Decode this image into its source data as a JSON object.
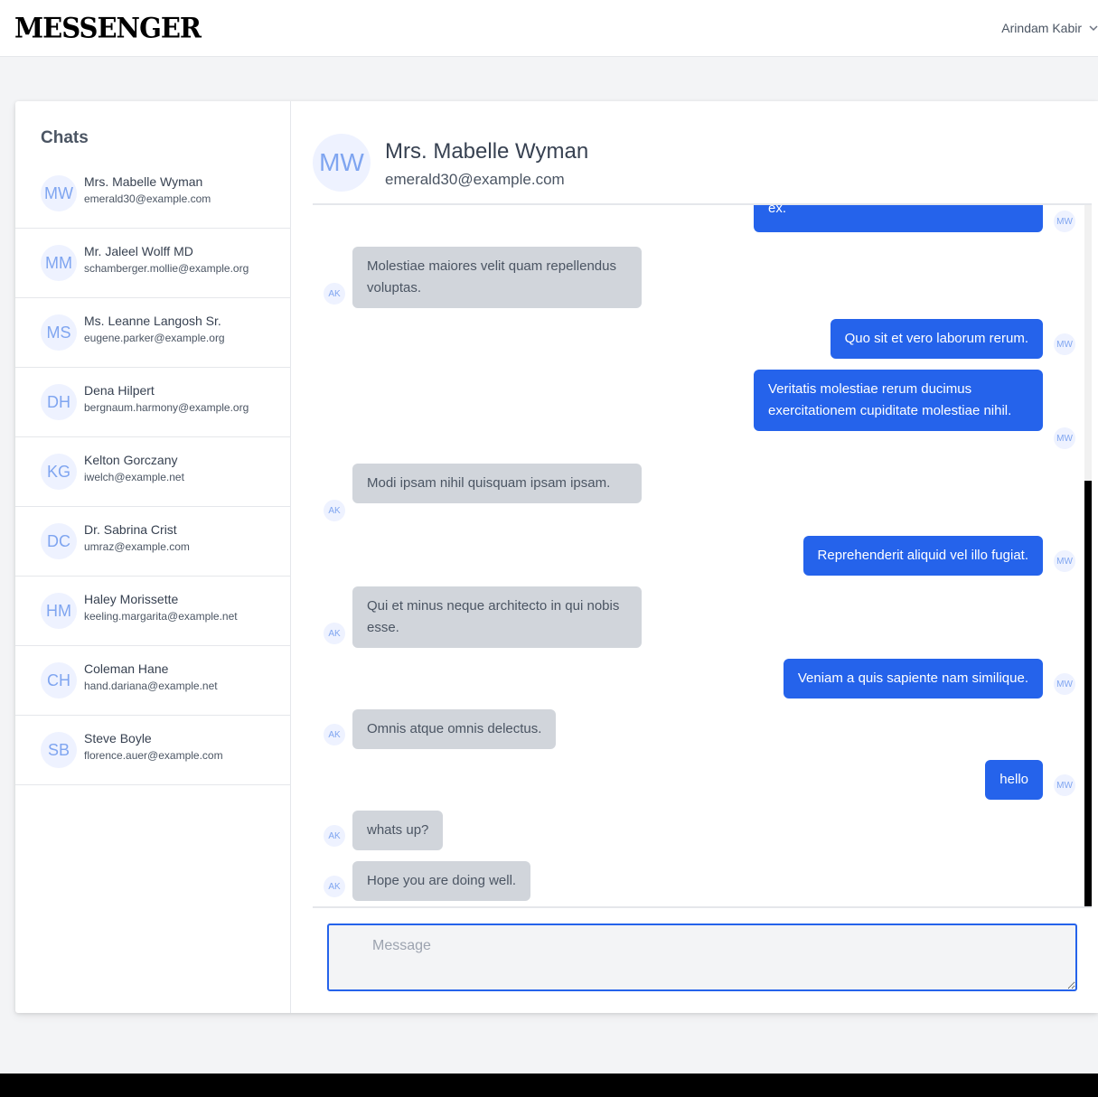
{
  "app": {
    "title": "MESSENGER"
  },
  "user_menu": {
    "name": "Arindam Kabir",
    "icon": "chevron-down-icon"
  },
  "sidebar": {
    "title": "Chats",
    "contacts": [
      {
        "initials": "MW",
        "name": "Mrs. Mabelle Wyman",
        "email": "emerald30@example.com"
      },
      {
        "initials": "MM",
        "name": "Mr. Jaleel Wolff MD",
        "email": "schamberger.mollie@example.org"
      },
      {
        "initials": "MS",
        "name": "Ms. Leanne Langosh Sr.",
        "email": "eugene.parker@example.org"
      },
      {
        "initials": "DH",
        "name": "Dena Hilpert",
        "email": "bergnaum.harmony@example.org"
      },
      {
        "initials": "KG",
        "name": "Kelton Gorczany",
        "email": "iwelch@example.net"
      },
      {
        "initials": "DC",
        "name": "Dr. Sabrina Crist",
        "email": "umraz@example.com"
      },
      {
        "initials": "HM",
        "name": "Haley Morissette",
        "email": "keeling.margarita@example.net"
      },
      {
        "initials": "CH",
        "name": "Coleman Hane",
        "email": "hand.dariana@example.net"
      },
      {
        "initials": "SB",
        "name": "Steve Boyle",
        "email": "florence.auer@example.com"
      }
    ]
  },
  "chat": {
    "header": {
      "initials": "MW",
      "name": "Mrs. Mabelle Wyman",
      "email": "emerald30@example.com"
    },
    "messages": [
      {
        "dir": "out",
        "text": "ex.",
        "avatar": "MW"
      },
      {
        "dir": "in",
        "text": "Molestiae maiores velit quam repellendus voluptas.",
        "avatar": "AK"
      },
      {
        "dir": "out",
        "text": "Quo sit et vero laborum rerum.",
        "avatar": "MW"
      },
      {
        "dir": "out",
        "text": "Veritatis molestiae rerum ducimus exercitationem cupiditate molestiae nihil.",
        "avatar": "MW"
      },
      {
        "dir": "in",
        "text": "Modi ipsam nihil quisquam ipsam ipsam.",
        "avatar": "AK"
      },
      {
        "dir": "out",
        "text": "Reprehenderit aliquid vel illo fugiat.",
        "avatar": "MW"
      },
      {
        "dir": "in",
        "text": "Qui et minus neque architecto in qui nobis esse.",
        "avatar": "AK"
      },
      {
        "dir": "out",
        "text": "Veniam a quis sapiente nam similique.",
        "avatar": "MW"
      },
      {
        "dir": "in",
        "text": "Omnis atque omnis delectus.",
        "avatar": "AK"
      },
      {
        "dir": "out",
        "text": "hello",
        "avatar": "MW"
      },
      {
        "dir": "in",
        "text": "whats up?",
        "avatar": "AK"
      },
      {
        "dir": "in",
        "text": "Hope you are doing well.",
        "avatar": "AK"
      }
    ],
    "composer": {
      "placeholder": "Message",
      "value": ""
    }
  },
  "colors": {
    "accent": "#2563eb",
    "incoming_bubble": "#d1d5db",
    "avatar_bg": "#eef2ff",
    "avatar_text": "#7fa5f0"
  }
}
